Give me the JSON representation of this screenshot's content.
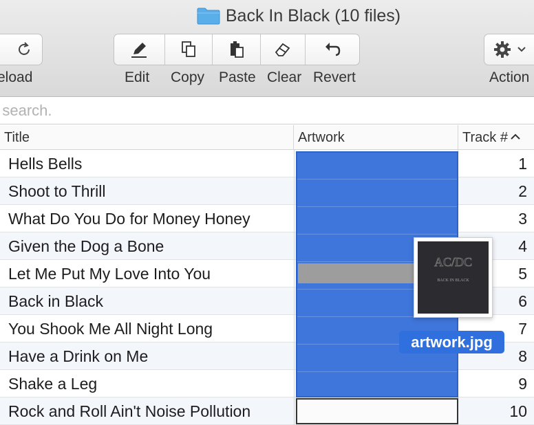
{
  "window": {
    "title": "Back In Black (10 files)",
    "folder_icon": "folder-icon"
  },
  "toolbar": {
    "reload_label": "eload",
    "edit_label": "Edit",
    "copy_label": "Copy",
    "paste_label": "Paste",
    "clear_label": "Clear",
    "revert_label": "Revert",
    "action_label": "Action"
  },
  "search": {
    "placeholder": "ve search."
  },
  "table": {
    "columns": {
      "title": "Title",
      "artwork": "Artwork",
      "track": "Track #",
      "sort_indicator": "^"
    },
    "rows": [
      {
        "title": "Hells Bells",
        "track": "1"
      },
      {
        "title": "Shoot to Thrill",
        "track": "2"
      },
      {
        "title": "What Do You Do for Money Honey",
        "track": "3"
      },
      {
        "title": "Given the Dog a Bone",
        "track": "4"
      },
      {
        "title": "Let Me Put My Love Into You",
        "track": "5"
      },
      {
        "title": "Back in Black",
        "track": "6"
      },
      {
        "title": "You Shook Me All Night Long",
        "track": "7"
      },
      {
        "title": "Have a Drink on Me",
        "track": "8"
      },
      {
        "title": "Shake a Leg",
        "track": "9"
      },
      {
        "title": "Rock and Roll Ain't Noise Pollution",
        "track": "10"
      }
    ]
  },
  "drag": {
    "filename": "artwork.jpg",
    "cover_logo": "AC/DC",
    "cover_text": "BACK IN BLACK"
  },
  "colors": {
    "selection": "#3f76dc",
    "drag_chip": "#2f6fde",
    "folder": "#5aaeea"
  }
}
